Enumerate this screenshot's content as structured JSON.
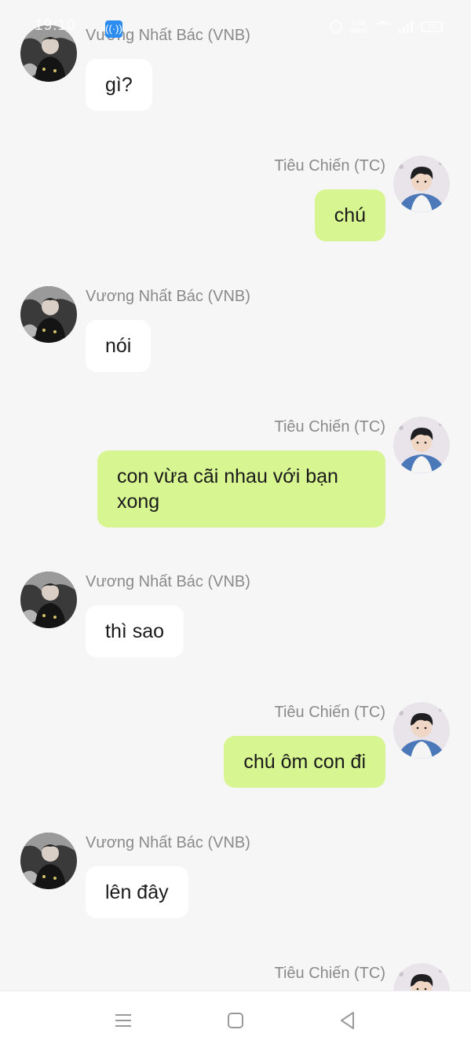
{
  "status_bar": {
    "time": "19:10",
    "hotspot_icon": "hotspot-icon",
    "speed": "0.00\nKB/S",
    "battery": "77"
  },
  "messages": [
    {
      "side": "left",
      "sender": "Vương Nhất Bác (VNB)",
      "text": "gì?",
      "avatar": "vnb"
    },
    {
      "side": "right",
      "sender": "Tiêu Chiến (TC)",
      "text": "chú",
      "avatar": "tc"
    },
    {
      "side": "left",
      "sender": "Vương Nhất Bác (VNB)",
      "text": "nói",
      "avatar": "vnb"
    },
    {
      "side": "right",
      "sender": "Tiêu Chiến (TC)",
      "text": "con vừa cãi nhau với bạn xong",
      "avatar": "tc"
    },
    {
      "side": "left",
      "sender": "Vương Nhất Bác (VNB)",
      "text": "thì sao",
      "avatar": "vnb"
    },
    {
      "side": "right",
      "sender": "Tiêu Chiến (TC)",
      "text": "chú ôm con đi",
      "avatar": "tc"
    },
    {
      "side": "left",
      "sender": "Vương Nhất Bác (VNB)",
      "text": "lên đây",
      "avatar": "vnb"
    },
    {
      "side": "right",
      "sender": "Tiêu Chiến (TC)",
      "text": "",
      "avatar": "tc"
    }
  ],
  "nav_bar": {
    "menu_icon": "menu-icon",
    "home_icon": "home-icon",
    "back_icon": "back-icon"
  },
  "colors": {
    "background": "#f6f6f6",
    "bubble_incoming": "#ffffff",
    "bubble_outgoing": "#d7f590",
    "sender_text": "#8a8a8a"
  }
}
